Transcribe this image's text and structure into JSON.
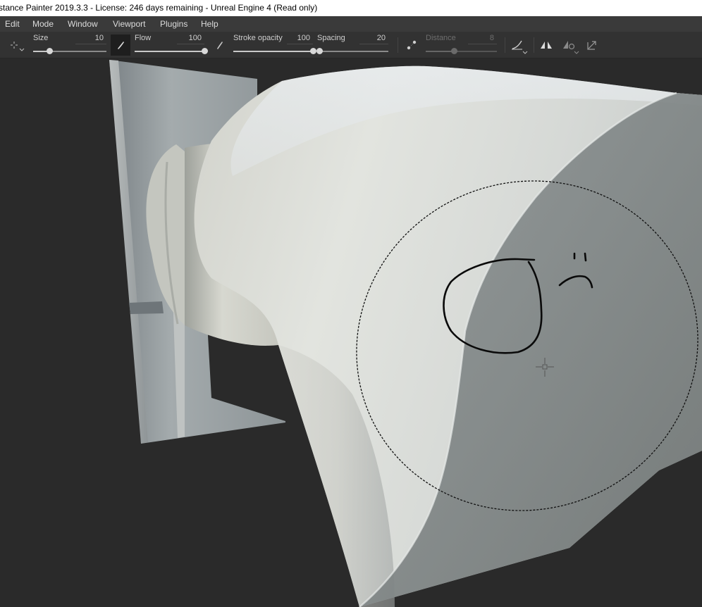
{
  "window": {
    "title": "stance Painter 2019.3.3 - License: 246 days remaining - Unreal Engine 4 (Read only)"
  },
  "menu": {
    "items": [
      "Edit",
      "Mode",
      "Window",
      "Viewport",
      "Plugins",
      "Help"
    ]
  },
  "toolbar": {
    "size": {
      "label": "Size",
      "value": "10",
      "level": 0.22
    },
    "flow": {
      "label": "Flow",
      "value": "100",
      "level": 1.0
    },
    "stroke_opacity": {
      "label": "Stroke opacity",
      "value": "100",
      "level": 1.0
    },
    "spacing": {
      "label": "Spacing",
      "value": "20",
      "level": 0.03
    },
    "distance": {
      "label": "Distance",
      "value": "8",
      "level": 0.4,
      "enabled": false
    }
  },
  "colors": {
    "titlebar_bg": "#ffffff",
    "menubar_bg": "#3a3a3a",
    "toolbar_bg": "#323232",
    "viewport_bg": "#2a2a2a",
    "model_light": "#dcdfdc",
    "model_shadow": "#8a8f8e"
  },
  "icons": {
    "pivot": "crosshair-icon",
    "brush_alpha": "brush-stroke-icon",
    "flow_jitter": "brush-jitter-icon",
    "lazy_mouse": "lazy-mouse-icon",
    "alignment": "alignment-icon",
    "symmetry": "symmetry-icon",
    "symmetry_settings": "symmetry-settings-icon",
    "fit_to_view": "resize-arrows-icon"
  }
}
